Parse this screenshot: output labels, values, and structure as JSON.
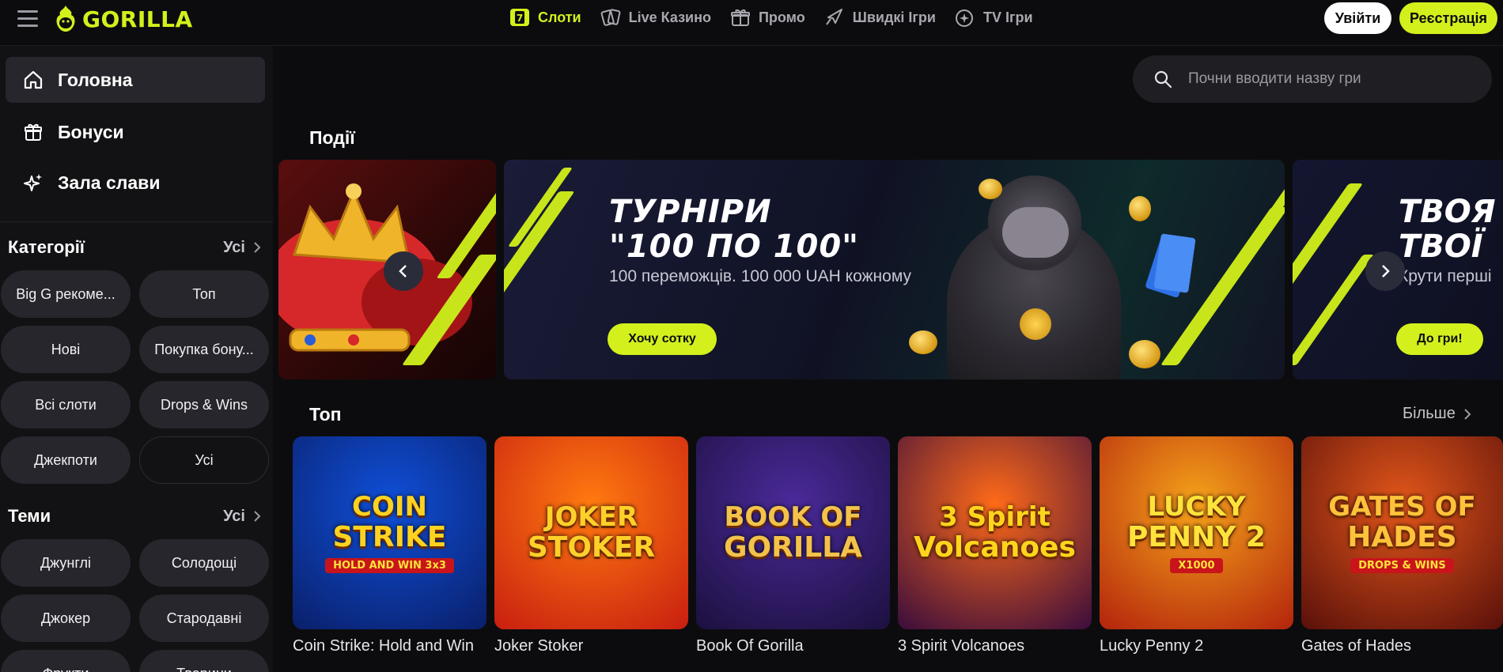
{
  "header": {
    "logo_text": "GORILLA",
    "nav": [
      {
        "label": "Слоти",
        "icon": "slots-icon",
        "active": true
      },
      {
        "label": "Live Казино",
        "icon": "cards-icon",
        "active": false
      },
      {
        "label": "Промо",
        "icon": "gift-icon",
        "active": false
      },
      {
        "label": "Швидкі Ігри",
        "icon": "rocket-icon",
        "active": false
      },
      {
        "label": "TV Ігри",
        "icon": "tv-sparkle-icon",
        "active": false
      }
    ],
    "slots_badge": "7",
    "login_label": "Увійти",
    "register_label": "Реєстрація"
  },
  "sidebar": {
    "links": [
      {
        "label": "Головна",
        "icon": "home-icon",
        "active": true
      },
      {
        "label": "Бонуси",
        "icon": "gift-icon",
        "active": false
      },
      {
        "label": "Зала слави",
        "icon": "sparkle-icon",
        "active": false
      }
    ],
    "categories": {
      "title": "Категорії",
      "all_label": "Усі",
      "items": [
        "Big G рекоме...",
        "Топ",
        "Нові",
        "Покупка бону...",
        "Всі слоти",
        "Drops & Wins",
        "Джекпоти",
        "Усі"
      ]
    },
    "themes": {
      "title": "Теми",
      "all_label": "Усі",
      "items": [
        "Джунглі",
        "Солодощі",
        "Джокер",
        "Стародавні",
        "Фрукти",
        "Тварини"
      ]
    }
  },
  "search": {
    "placeholder": "Почни вводити назву гри"
  },
  "events": {
    "title": "Події",
    "main_banner": {
      "title_line1": "ТУРНІРИ",
      "title_line2": "\"100 ПО 100\"",
      "subtitle": "100 переможців. 100 000 UAH кожному",
      "cta": "Хочу сотку"
    },
    "right_banner": {
      "title_line1": "ТВОЯ",
      "title_line2": "ТВОЇ",
      "subtitle": "Крути перші",
      "cta": "До гри!"
    },
    "dots_count": 2,
    "active_dot": 1
  },
  "top": {
    "title": "Топ",
    "more_label": "Більше",
    "games": [
      {
        "name": "Coin Strike: Hold and Win",
        "art_line1": "COIN",
        "art_line2": "STRIKE",
        "art_tag": "HOLD AND WIN 3x3",
        "bg1": "#0f4fd8",
        "bg2": "#0a1f6a",
        "fg": "#ffd21f"
      },
      {
        "name": "Joker Stoker",
        "art_line1": "JOKER",
        "art_line2": "STOKER",
        "art_tag": "",
        "bg1": "#ff7a10",
        "bg2": "#c81e10",
        "fg": "#ffcf2a"
      },
      {
        "name": "Book Of Gorilla",
        "art_line1": "BOOK OF",
        "art_line2": "GORILLA",
        "art_tag": "",
        "bg1": "#4a2a9a",
        "bg2": "#1c103e",
        "fg": "#f2c24a"
      },
      {
        "name": "3 Spirit Volcanoes",
        "art_line1": "3 Spirit",
        "art_line2": "Volcanoes",
        "art_tag": "",
        "bg1": "#ff6a18",
        "bg2": "#3a0c3c",
        "fg": "#ffd41c"
      },
      {
        "name": "Lucky Penny 2",
        "art_line1": "LUCKY",
        "art_line2": "PENNY 2",
        "art_tag": "X1000",
        "bg1": "#f5a21a",
        "bg2": "#b3240c",
        "fg": "#ffe23a"
      },
      {
        "name": "Gates of Hades",
        "art_line1": "GATES OF",
        "art_line2": "HADES",
        "art_tag": "DROPS & WINS",
        "bg1": "#e2561a",
        "bg2": "#5a100a",
        "fg": "#ffc23a"
      }
    ]
  },
  "colors": {
    "accent": "#d3f01c",
    "background": "#0c0c0e",
    "sidebar": "#121214",
    "pill": "#26262c"
  }
}
